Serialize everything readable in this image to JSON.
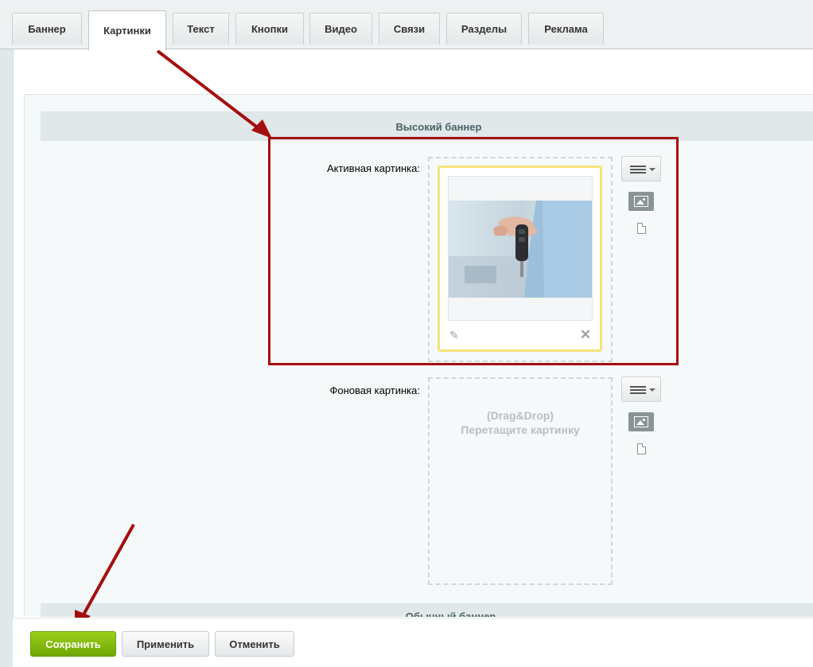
{
  "tabs": [
    {
      "label": "Баннер"
    },
    {
      "label": "Картинки",
      "active": true
    },
    {
      "label": "Текст"
    },
    {
      "label": "Кнопки"
    },
    {
      "label": "Видео"
    },
    {
      "label": "Связи"
    },
    {
      "label": "Разделы"
    },
    {
      "label": "Реклама"
    }
  ],
  "sections": {
    "tall_banner": "Высокий баннер",
    "normal_banner": "Обычный баннер"
  },
  "fields": {
    "active_image": {
      "label": "Активная картинка:",
      "icons": [
        "menu-icon",
        "image-icon",
        "file-icon",
        "edit-icon",
        "delete-icon"
      ],
      "delete_glyph": "✕",
      "edit_glyph": "✎"
    },
    "background_image": {
      "label": "Фоновая картинка:",
      "dropzone_line1": "(Drag&Drop)",
      "dropzone_line2": "Перетащите картинку"
    }
  },
  "buttons": {
    "save": "Сохранить",
    "apply": "Применить",
    "cancel": "Отменить"
  },
  "colors": {
    "annotation": "#a50e0e",
    "save_button": "#7bb80c",
    "preview_border": "#f7e27a"
  }
}
